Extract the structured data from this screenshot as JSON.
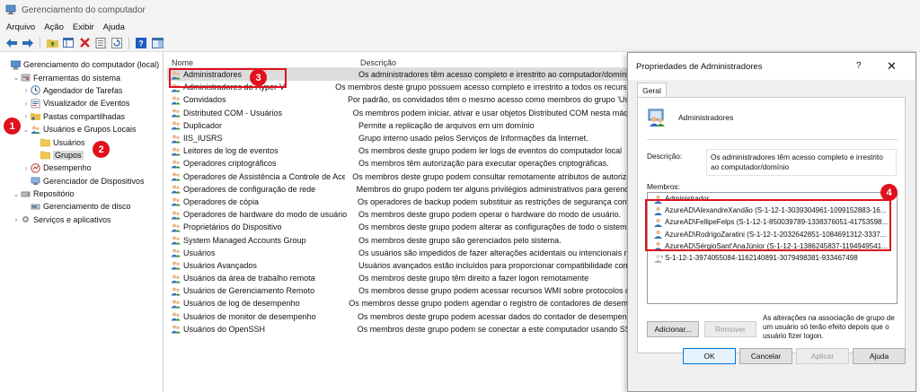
{
  "window": {
    "title": "Gerenciamento do computador"
  },
  "menu": [
    "Arquivo",
    "Ação",
    "Exibir",
    "Ajuda"
  ],
  "toolbar_icons": [
    "back-arrow-icon",
    "forward-arrow-icon",
    "up-folder-icon",
    "properties-grid-icon",
    "delete-icon",
    "export-list-icon",
    "refresh-icon",
    "help-icon",
    "show-pane-icon"
  ],
  "tree": [
    {
      "label": "Gerenciamento do computador (local)",
      "indent": 0,
      "exp": "",
      "icon": "computer-management-icon"
    },
    {
      "label": "Ferramentas do sistema",
      "indent": 1,
      "exp": "v",
      "icon": "system-tools-icon"
    },
    {
      "label": "Agendador de Tarefas",
      "indent": 2,
      "exp": ">",
      "icon": "clock-icon"
    },
    {
      "label": "Visualizador de Eventos",
      "indent": 2,
      "exp": ">",
      "icon": "event-viewer-icon"
    },
    {
      "label": "Pastas compartilhadas",
      "indent": 2,
      "exp": ">",
      "icon": "shared-folder-icon"
    },
    {
      "label": "Usuários e Grupos Locais",
      "indent": 2,
      "exp": "v",
      "icon": "users-groups-icon"
    },
    {
      "label": "Usuários",
      "indent": 3,
      "exp": "",
      "icon": "folder-icon"
    },
    {
      "label": "Grupos",
      "indent": 3,
      "exp": "",
      "icon": "folder-icon",
      "selected": true
    },
    {
      "label": "Desempenho",
      "indent": 2,
      "exp": ">",
      "icon": "performance-icon"
    },
    {
      "label": "Gerenciador de Dispositivos",
      "indent": 2,
      "exp": "",
      "icon": "device-manager-icon"
    },
    {
      "label": "Repositório",
      "indent": 1,
      "exp": "v",
      "icon": "storage-icon"
    },
    {
      "label": "Gerenciamento de disco",
      "indent": 2,
      "exp": "",
      "icon": "disk-icon"
    },
    {
      "label": "Serviços e aplicativos",
      "indent": 1,
      "exp": ">",
      "icon": "services-icon"
    }
  ],
  "list": {
    "headers": {
      "name": "Nome",
      "description": "Descrição"
    },
    "rows": [
      {
        "name": "Administradores",
        "description": "Os administradores têm acesso completo e irrestrito ao computador/domínio",
        "selected": true
      },
      {
        "name": "Administradores do Hyper-V",
        "description": "Os membros deste grupo possuem acesso completo e irrestrito a todos os recursos do Hyper-V"
      },
      {
        "name": "Convidados",
        "description": "Por padrão, os convidados têm o mesmo acesso como membros do grupo 'Usuários'"
      },
      {
        "name": "Distributed COM - Usuários",
        "description": "Os membros podem iniciar, ativar e usar objetos Distributed COM nesta máquina"
      },
      {
        "name": "Duplicador",
        "description": "Permite a replicação de arquivos em um domínio"
      },
      {
        "name": "IIS_IUSRS",
        "description": "Grupo interno usado pelos Serviços de Informações da Internet."
      },
      {
        "name": "Leitores de log de eventos",
        "description": "Os membros deste grupo podem ler logs de eventos do computador local"
      },
      {
        "name": "Operadores criptográficos",
        "description": "Os membros têm autorização para executar operações criptográficas."
      },
      {
        "name": "Operadores de Assistência a Controle de Aces...",
        "description": "Os membros deste grupo podem consultar remotamente atributos de autorização"
      },
      {
        "name": "Operadores de configuração de rede",
        "description": "Membros do grupo podem ter alguns privilégios administrativos para gerenciar"
      },
      {
        "name": "Operadores de cópia",
        "description": "Os operadores de backup podem substituir as restrições de segurança com o"
      },
      {
        "name": "Operadores de hardware do modo de usuário",
        "description": "Os membros deste grupo podem operar o hardware do modo de usuário."
      },
      {
        "name": "Proprietários do Dispositivo",
        "description": "Os membros deste grupo podem alterar as configurações de todo o sistema."
      },
      {
        "name": "System Managed Accounts Group",
        "description": "Os membros deste grupo são gerenciados pelo sistema."
      },
      {
        "name": "Usuários",
        "description": "Os usuários são impedidos de fazer alterações acidentais ou intencionais no"
      },
      {
        "name": "Usuários Avançados",
        "description": "Usuários avançados estão incluídos para proporcionar compatibilidade com"
      },
      {
        "name": "Usuários da área de trabalho remota",
        "description": "Os membros deste grupo têm direito a fazer logon remotamente"
      },
      {
        "name": "Usuários de Gerenciamento Remoto",
        "description": "Os membros desse grupo podem acessar recursos WMI sobre protocolos de"
      },
      {
        "name": "Usuários de log de desempenho",
        "description": "Os membros desse grupo podem agendar o registro de contadores de desempenho"
      },
      {
        "name": "Usuários de monitor de desempenho",
        "description": "Os membros deste grupo podem acessar dados do contador de desempenho"
      },
      {
        "name": "Usuários do OpenSSH",
        "description": "Os membros deste grupo podem se conectar a este computador usando SSH"
      }
    ]
  },
  "dialog": {
    "title": "Propriedades de Administradores",
    "help": "?",
    "close": "✕",
    "tab": "Geral",
    "group_name": "Administradores",
    "desc_label": "Descrição:",
    "desc_value": "Os administradores têm acesso completo e irrestrito ao computador/domínio",
    "members_label": "Membros:",
    "members": [
      "Administrador",
      "AzureAD\\AlexandreXandão (S-1-12-1-3039304961-1099152883-16...",
      "AzureAD\\FellipeFelps (S-1-12-1-850039789-1338376051-41753598...",
      "AzureAD\\RodrigoZaratini (S-1-12-1-2032642851-1084691312-3337...",
      "AzureAD\\SérgioSant'AnaJúnior (S-1-12-1-1386245837-1194949541...",
      "S-1-12-1-3974055084-1162140891-3079498381-933467498"
    ],
    "add_button": "Adicionar...",
    "remove_button": "Remover",
    "note": "As alterações na associação de grupo de um usuário só terão efeito depois que o usuário fizer logon.",
    "ok": "OK",
    "cancel": "Cancelar",
    "apply": "Aplicar",
    "help_button": "Ajuda"
  },
  "callouts": [
    "1",
    "2",
    "3",
    "4"
  ],
  "colors": {
    "callout": "#e0101c",
    "selection": "#d9d9d9",
    "primary_border": "#0078d7"
  }
}
